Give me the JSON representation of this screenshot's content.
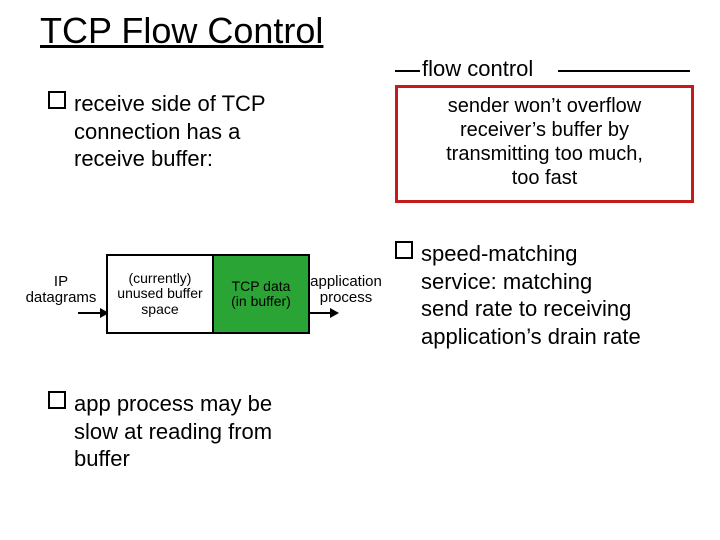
{
  "title": "TCP Flow Control",
  "left_bullets": {
    "b1_part1": "receive side of TCP",
    "b1_part2": "connection has a",
    "b1_part3": "receive buffer:",
    "b2_part1": "app process may be",
    "b2_part2": "slow at reading from",
    "b2_part3": "buffer"
  },
  "diagram": {
    "ip_line1": "IP",
    "ip_line2": "datagrams",
    "unused_line1": "(currently)",
    "unused_line2": "unused buffer",
    "unused_line3": "space",
    "tcp_line1": "TCP data",
    "tcp_line2": "(in buffer)",
    "app_line1": "application",
    "app_line2": "process"
  },
  "flow_control": {
    "label": "flow control",
    "box_line1": "sender won’t overflow",
    "box_line2": "receiver’s buffer by",
    "box_line3": "transmitting too much,",
    "box_line4": "too fast"
  },
  "right_bullet": {
    "part1a": "speed-matching",
    "part1b": "service:",
    "part2": " matching",
    "part3": "send rate to receiving",
    "part4": "application’s drain rate"
  }
}
